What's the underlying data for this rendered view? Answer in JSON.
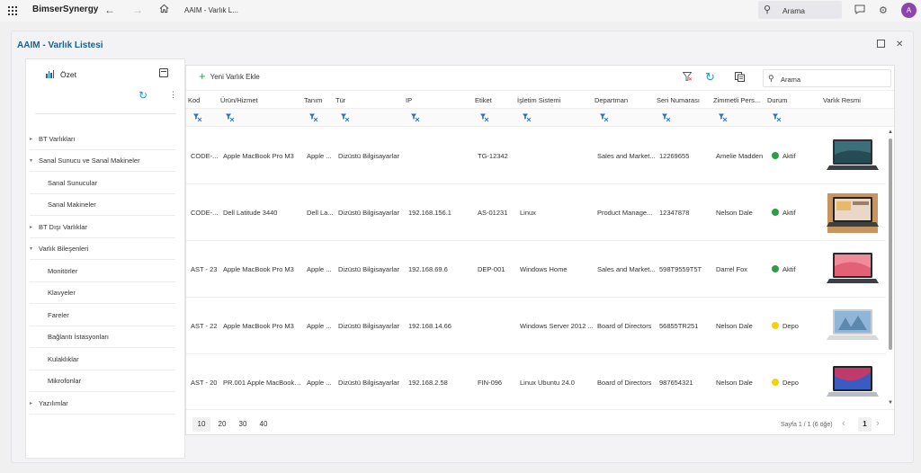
{
  "topbar": {
    "app_name": "BimserSynergy",
    "breadcrumb": "AAIM - Varlık L...",
    "search_label": "Arama",
    "avatar_letter": "A"
  },
  "window": {
    "title": "AAIM - Varlık Listesi"
  },
  "sidebar": {
    "summary_label": "Özet",
    "tree": [
      {
        "label": "BT Varlıkları",
        "level": 0,
        "expanded": false
      },
      {
        "label": "Sanal Sunucu ve Sanal Makineler",
        "level": 0,
        "expanded": true
      },
      {
        "label": "Sanal Sunucular",
        "level": 1
      },
      {
        "label": "Sanal Makineler",
        "level": 1
      },
      {
        "label": "BT Dışı Varlıklar",
        "level": 0,
        "expanded": false
      },
      {
        "label": "Varlık Bileşenleri",
        "level": 0,
        "expanded": true
      },
      {
        "label": "Monitörler",
        "level": 1
      },
      {
        "label": "Klavyeler",
        "level": 1
      },
      {
        "label": "Fareler",
        "level": 1
      },
      {
        "label": "Bağlantı İstasyonları",
        "level": 1
      },
      {
        "label": "Kulaklıklar",
        "level": 1
      },
      {
        "label": "Mikrofonlar",
        "level": 1
      },
      {
        "label": "Yazılımlar",
        "level": 0,
        "expanded": false
      }
    ]
  },
  "toolbar": {
    "add_label": "Yeni Varlık Ekle",
    "search_placeholder": "Arama"
  },
  "table": {
    "columns": [
      "Kod",
      "Ürün/Hizmet",
      "Tanım",
      "Tür",
      "IP",
      "Etiket",
      "İşletim Sistemi",
      "Departman",
      "Seri Numarası",
      "Zimmetli Pers...",
      "Durum",
      "Varlık Resmi"
    ],
    "rows": [
      {
        "kod": "CODE-...",
        "urun": "Apple MacBook Pro M3",
        "tanim": "Apple ...",
        "tur": "Dizüstü Bilgisayarlar",
        "ip": "",
        "etiket": "TG-12342",
        "os": "",
        "departman": "Sales and Market...",
        "seri": "12269655",
        "zimmet": "Amelie Madden",
        "durum": "Aktif",
        "durum_color": "#2e9e44",
        "image": "laptop-dark"
      },
      {
        "kod": "CODE-...",
        "urun": "Dell Latitude 3440",
        "tanim": "Dell La...",
        "tur": "Dizüstü Bilgisayarlar",
        "ip": "192.168.156.1",
        "etiket": "AS-01231",
        "os": "Linux",
        "departman": "Product Manage...",
        "seri": "12347878",
        "zimmet": "Nelson Dale",
        "durum": "Aktif",
        "durum_color": "#2e9e44",
        "image": "laptop-wood"
      },
      {
        "kod": "AST - 23",
        "urun": "Apple MacBook Pro M3",
        "tanim": "Apple ...",
        "tur": "Dizüstü Bilgisayarlar",
        "ip": "192.168.69.6",
        "etiket": "DEP-001",
        "os": "Windows Home",
        "departman": "Sales and Market...",
        "seri": "598T9559T5T",
        "zimmet": "Darrel Fox",
        "durum": "Aktif",
        "durum_color": "#2e9e44",
        "image": "laptop-pink"
      },
      {
        "kod": "AST - 22",
        "urun": "Apple MacBook Pro M3",
        "tanim": "Apple ...",
        "tur": "Dizüstü Bilgisayarlar",
        "ip": "192.168.14.66",
        "etiket": "",
        "os": "Windows Server 2012 ...",
        "departman": "Board of Directors",
        "seri": "56855TR251",
        "zimmet": "Nelson Dale",
        "durum": "Depo",
        "durum_color": "#f2d20c",
        "image": "laptop-silver"
      },
      {
        "kod": "AST - 20",
        "urun": "PR.001 Apple MacBook P...",
        "tanim": "Apple ...",
        "tur": "Dizüstü Bilgisayarlar",
        "ip": "192.168.2.58",
        "etiket": "FIN-096",
        "os": "Linux Ubuntu 24.0",
        "departman": "Board of Directors",
        "seri": "987654321",
        "zimmet": "Nelson Dale",
        "durum": "Depo",
        "durum_color": "#f2d20c",
        "image": "macbook"
      }
    ]
  },
  "pager": {
    "sizes": [
      "10",
      "20",
      "30",
      "40"
    ],
    "active_size": "10",
    "info": "Sayfa 1 / 1 (6 öğe)",
    "current_page": "1"
  },
  "colors": {
    "accent": "#2a8fd6",
    "add_green": "#2f9e44",
    "title_blue": "#1e5f8a"
  }
}
